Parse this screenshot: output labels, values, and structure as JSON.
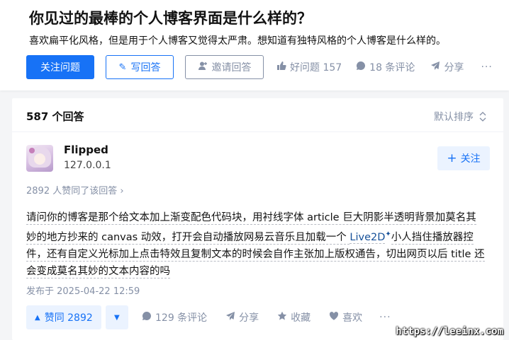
{
  "question": {
    "title": "你见过的最棒的个人博客界面是什么样的？",
    "description": "喜欢扁平化风格，但是用于个人博客又觉得太严肃。想知道有独特风格的个人博客是什么样的。",
    "actions": {
      "follow_label": "关注问题",
      "write_label": "写回答",
      "invite_label": "邀请回答",
      "good_label": "好问题 157",
      "comments_label": "18 条评论",
      "share_label": "分享",
      "more_label": "···"
    }
  },
  "answers": {
    "count_label": "587 个回答",
    "sort_label": "默认排序"
  },
  "answer": {
    "author_name": "Flipped",
    "author_bio": "127.0.0.1",
    "follow_label": "关注",
    "voters_label": "2892 人赞同了该回答 ›",
    "content_before": "请问你的博客是那个给文本加上渐变配色代码块，用衬线字体 article 巨大阴影半透明背景加莫名其妙的地方抄来的 canvas 动效，打开会自动播放网易云音乐且加载一个 ",
    "content_link": "Live2D",
    "content_after": "小人挡住播放器控件，还有自定义光标加上点击特效且复制文本的时候会自作主张加上版权通告，切出网页以后 title 还会变成莫名其妙的文本内容的吗",
    "published": "发布于 2025-04-22 12:59",
    "upvote_label": "赞同 2892",
    "comments_label": "129 条评论",
    "share_label": "分享",
    "favorite_label": "收藏",
    "like_label": "喜欢",
    "more_label": "···"
  },
  "watermark": "https://leeinx.com",
  "colors": {
    "accent": "#1772f6",
    "accent_light": "#ebf3ff",
    "muted": "#8590a6",
    "background": "#f4f5f7"
  }
}
